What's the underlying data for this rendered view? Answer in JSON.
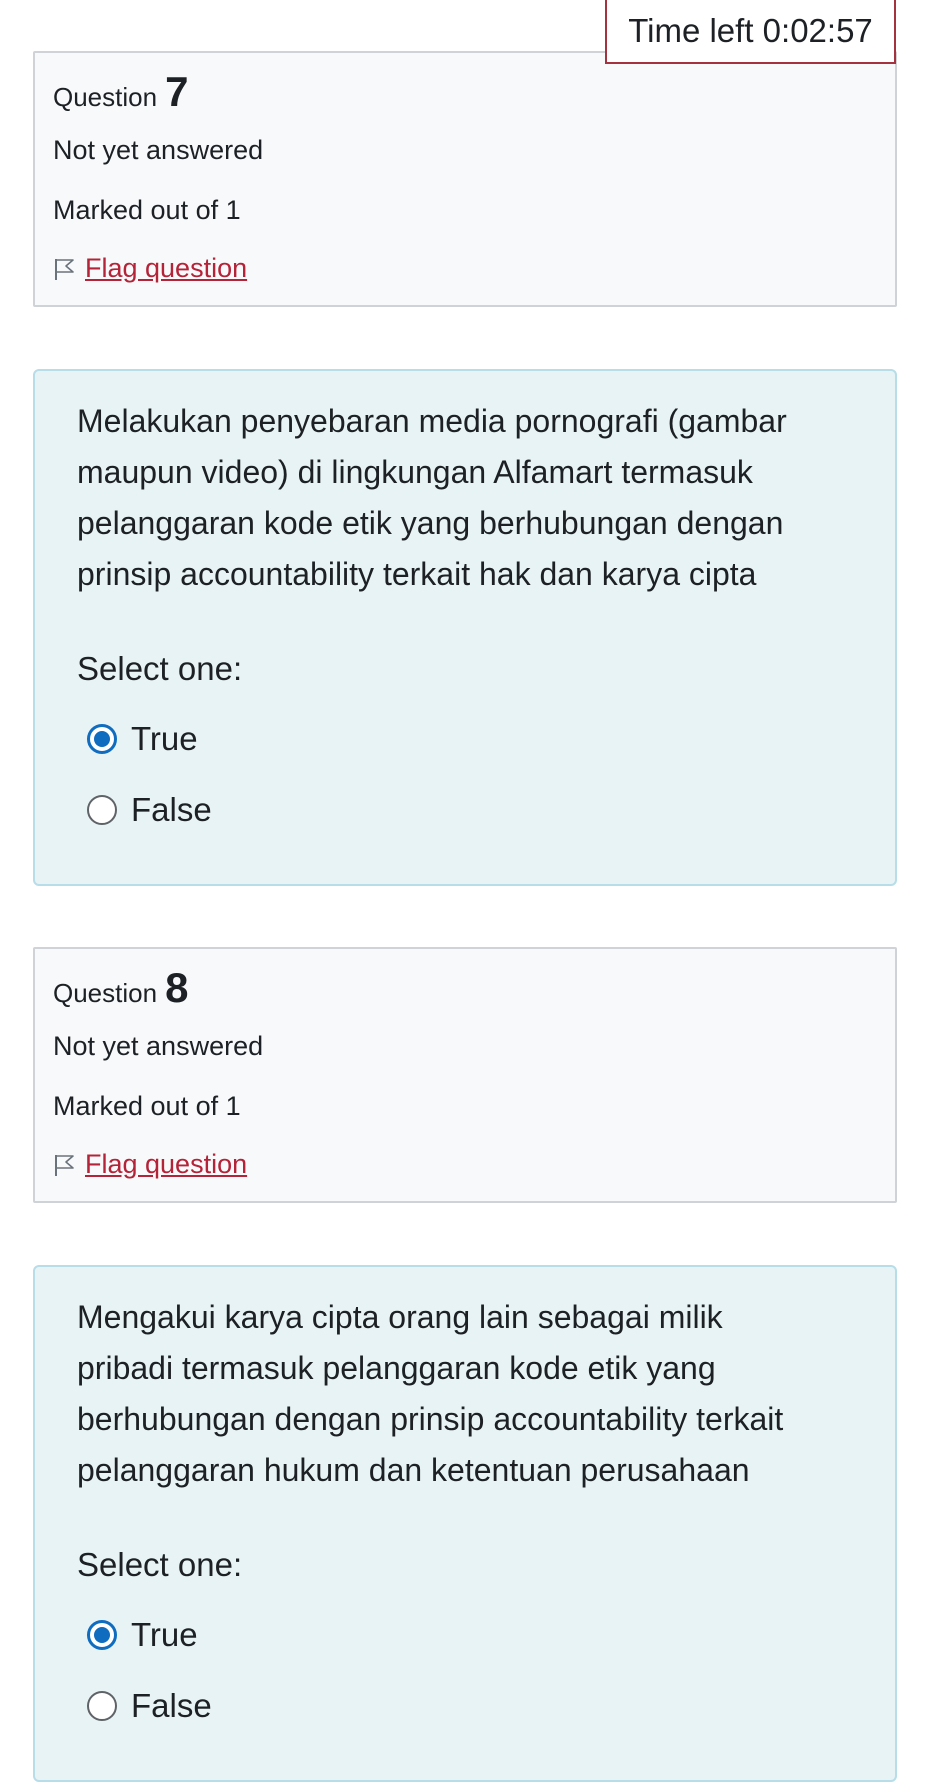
{
  "timer": {
    "label": "Time left",
    "value": "0:02:57"
  },
  "questions": [
    {
      "label": "Question",
      "number": "7",
      "status": "Not yet answered",
      "marks": "Marked out of 1",
      "flag_label": "Flag question",
      "text_lines": [
        "Melakukan penyebaran media pornografi (gambar",
        "maupun video) di lingkungan Alfamart termasuk",
        "pelanggaran kode etik yang berhubungan dengan",
        "prinsip accountability terkait hak dan karya cipta"
      ],
      "prompt": "Select one:",
      "options": [
        {
          "label": "True",
          "selected": true
        },
        {
          "label": "False",
          "selected": false
        }
      ]
    },
    {
      "label": "Question",
      "number": "8",
      "status": "Not yet answered",
      "marks": "Marked out of 1",
      "flag_label": "Flag question",
      "text_lines": [
        "Mengakui karya cipta orang lain sebagai milik",
        "pribadi termasuk pelanggaran kode etik yang",
        "berhubungan dengan prinsip accountability terkait",
        "pelanggaran hukum dan ketentuan perusahaan"
      ],
      "prompt": "Select one:",
      "options": [
        {
          "label": "True",
          "selected": true
        },
        {
          "label": "False",
          "selected": false
        }
      ]
    }
  ],
  "colors": {
    "accent": "#0f6cbf",
    "flag_link": "#b42338",
    "timer_border": "#a5333f",
    "info_bg": "#f8f9fa",
    "content_bg": "#e7f3f5"
  }
}
